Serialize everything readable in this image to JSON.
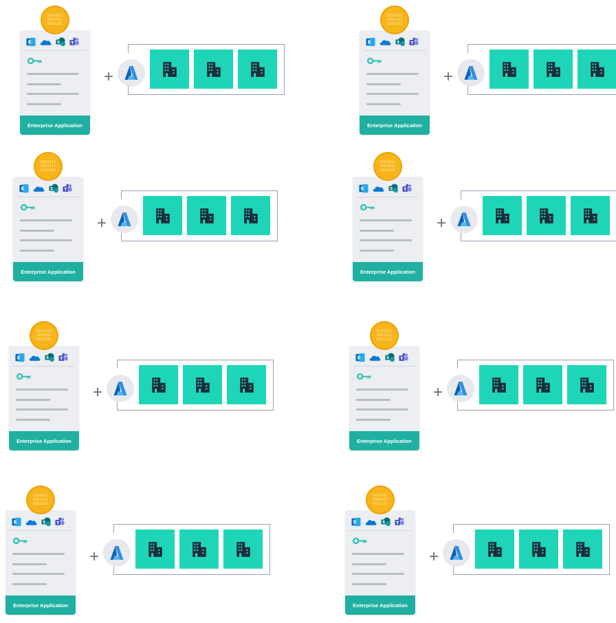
{
  "coin": {
    "lines": [
      "0101011",
      "1001011",
      "0101101"
    ]
  },
  "card": {
    "footer_label": "Enterprise Application",
    "icons": [
      "exchange-icon",
      "onedrive-icon",
      "sharepoint-icon",
      "teams-icon"
    ],
    "key_icon": "key-icon"
  },
  "combine_symbol": "+",
  "tenant": {
    "icon": "azure-icon",
    "organizations": [
      "building-icon",
      "building-icon",
      "building-icon"
    ]
  },
  "colors": {
    "coin": "#f7b51c",
    "footer": "#1fb0a1",
    "organization": "#1ed6b7",
    "card": "#eceef2"
  }
}
